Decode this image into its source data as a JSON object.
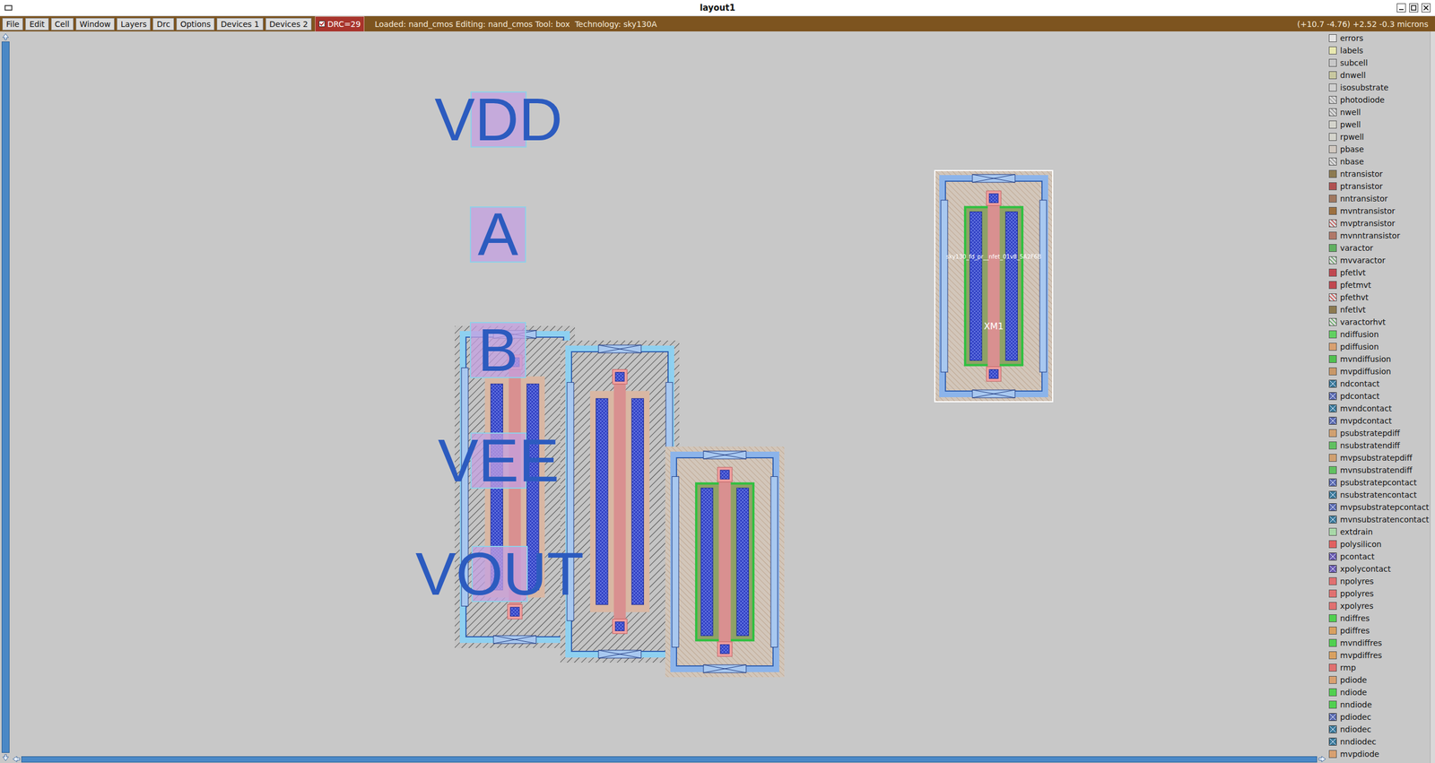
{
  "window": {
    "title": "layout1"
  },
  "menu": [
    {
      "label": "File"
    },
    {
      "label": "Edit"
    },
    {
      "label": "Cell"
    },
    {
      "label": "Window"
    },
    {
      "label": "Layers"
    },
    {
      "label": "Drc"
    },
    {
      "label": "Options"
    },
    {
      "label": "Devices 1"
    },
    {
      "label": "Devices 2"
    }
  ],
  "drc": {
    "label": "DRC=29",
    "checked": true
  },
  "status": "Loaded: nand_cmos Editing: nand_cmos Tool: box  Technology: sky130A",
  "coordinates": "(+10.7 -4.76) +2.52 -0.3 microns",
  "canvas": {
    "labels": [
      {
        "text": "VDD"
      },
      {
        "text": "A"
      },
      {
        "text": "B"
      },
      {
        "text": "VEE"
      },
      {
        "text": "VOUT"
      }
    ],
    "devices": [
      {
        "kind": "pfet",
        "selected": false,
        "instance": "",
        "cell": ""
      },
      {
        "kind": "pfet",
        "selected": false,
        "instance": "",
        "cell": ""
      },
      {
        "kind": "nfet",
        "selected": false,
        "instance": "",
        "cell": ""
      },
      {
        "kind": "nfet",
        "selected": true,
        "instance": "XM1",
        "cell": "sky130_fd_pr__nfet_01v8_5A2F6B"
      }
    ]
  },
  "layers": [
    {
      "name": "errors",
      "color": "#e4e4e4",
      "kind": "solid"
    },
    {
      "name": "labels",
      "color": "#e8e8b0",
      "kind": "solid"
    },
    {
      "name": "subcell",
      "color": "#c8c8c8",
      "kind": "solid"
    },
    {
      "name": "dnwell",
      "color": "#c8c8a0",
      "kind": "solid"
    },
    {
      "name": "isosubstrate",
      "color": "#d0d0d0",
      "kind": "solid"
    },
    {
      "name": "photodiode",
      "color": "#a0a0a0",
      "kind": "hatch"
    },
    {
      "name": "nwell",
      "color": "#909090",
      "kind": "hatch"
    },
    {
      "name": "pwell",
      "color": "#d4d4cc",
      "kind": "solid"
    },
    {
      "name": "rpwell",
      "color": "#d4d4cc",
      "kind": "solid"
    },
    {
      "name": "pbase",
      "color": "#d0c8c0",
      "kind": "solid"
    },
    {
      "name": "nbase",
      "color": "#909090",
      "kind": "hatch"
    },
    {
      "name": "ntransistor",
      "color": "#8c7a50",
      "kind": "solid"
    },
    {
      "name": "ptransistor",
      "color": "#b05050",
      "kind": "solid"
    },
    {
      "name": "nntransistor",
      "color": "#a07860",
      "kind": "solid"
    },
    {
      "name": "mvntransistor",
      "color": "#9c7040",
      "kind": "solid"
    },
    {
      "name": "mvptransistor",
      "color": "#c04848",
      "kind": "hatch"
    },
    {
      "name": "mvnntransistor",
      "color": "#b07868",
      "kind": "solid"
    },
    {
      "name": "varactor",
      "color": "#60b060",
      "kind": "solid"
    },
    {
      "name": "mvvaractor",
      "color": "#60a060",
      "kind": "hatch"
    },
    {
      "name": "pfetlvt",
      "color": "#c04850",
      "kind": "solid"
    },
    {
      "name": "pfetmvt",
      "color": "#c04850",
      "kind": "solid"
    },
    {
      "name": "pfethvt",
      "color": "#d04040",
      "kind": "hatch"
    },
    {
      "name": "nfetlvt",
      "color": "#8c7a50",
      "kind": "solid"
    },
    {
      "name": "varactorhvt",
      "color": "#58a858",
      "kind": "hatch"
    },
    {
      "name": "ndiffusion",
      "color": "#60d060",
      "kind": "solid"
    },
    {
      "name": "pdiffusion",
      "color": "#d8a070",
      "kind": "solid"
    },
    {
      "name": "mvndiffusion",
      "color": "#50c050",
      "kind": "solid"
    },
    {
      "name": "mvpdiffusion",
      "color": "#c89868",
      "kind": "solid"
    },
    {
      "name": "ndcontact",
      "color": "#3a7a9a",
      "kind": "contact"
    },
    {
      "name": "pdcontact",
      "color": "#5a6ab0",
      "kind": "contact"
    },
    {
      "name": "mvndcontact",
      "color": "#3a7a9a",
      "kind": "contact"
    },
    {
      "name": "mvpdcontact",
      "color": "#5a6ab0",
      "kind": "contact"
    },
    {
      "name": "psubstratepdiff",
      "color": "#d0a070",
      "kind": "solid"
    },
    {
      "name": "nsubstratendiff",
      "color": "#60c060",
      "kind": "solid"
    },
    {
      "name": "mvpsubstratepdiff",
      "color": "#d0a070",
      "kind": "solid"
    },
    {
      "name": "mvnsubstratendiff",
      "color": "#60c060",
      "kind": "solid"
    },
    {
      "name": "psubstratepcontact",
      "color": "#5a6ab0",
      "kind": "contact"
    },
    {
      "name": "nsubstratencontact",
      "color": "#3a7a9a",
      "kind": "contact"
    },
    {
      "name": "mvpsubstratepcontact",
      "color": "#5a6ab0",
      "kind": "contact"
    },
    {
      "name": "mvnsubstratencontact",
      "color": "#3a7a9a",
      "kind": "contact"
    },
    {
      "name": "extdrain",
      "color": "#a8d8a8",
      "kind": "solid"
    },
    {
      "name": "polysilicon",
      "color": "#e06060",
      "kind": "solid"
    },
    {
      "name": "pcontact",
      "color": "#6a5ab0",
      "kind": "contact"
    },
    {
      "name": "xpolycontact",
      "color": "#6a5ab0",
      "kind": "contact"
    },
    {
      "name": "npolyres",
      "color": "#e07070",
      "kind": "solid"
    },
    {
      "name": "ppolyres",
      "color": "#e07070",
      "kind": "solid"
    },
    {
      "name": "xpolyres",
      "color": "#e07070",
      "kind": "solid"
    },
    {
      "name": "ndiffres",
      "color": "#50d050",
      "kind": "solid"
    },
    {
      "name": "pdiffres",
      "color": "#d8a060",
      "kind": "solid"
    },
    {
      "name": "mvndiffres",
      "color": "#50d050",
      "kind": "solid"
    },
    {
      "name": "mvpdiffres",
      "color": "#d8a060",
      "kind": "solid"
    },
    {
      "name": "rmp",
      "color": "#e07070",
      "kind": "solid"
    },
    {
      "name": "pdiode",
      "color": "#d8a070",
      "kind": "solid"
    },
    {
      "name": "ndiode",
      "color": "#50d050",
      "kind": "solid"
    },
    {
      "name": "nndiode",
      "color": "#50d050",
      "kind": "solid"
    },
    {
      "name": "pdiodec",
      "color": "#5a6ab0",
      "kind": "contact"
    },
    {
      "name": "ndiodec",
      "color": "#3a7a9a",
      "kind": "contact"
    },
    {
      "name": "nndiodec",
      "color": "#3a7a9a",
      "kind": "contact"
    },
    {
      "name": "mvpdiode",
      "color": "#d8a070",
      "kind": "solid"
    }
  ]
}
